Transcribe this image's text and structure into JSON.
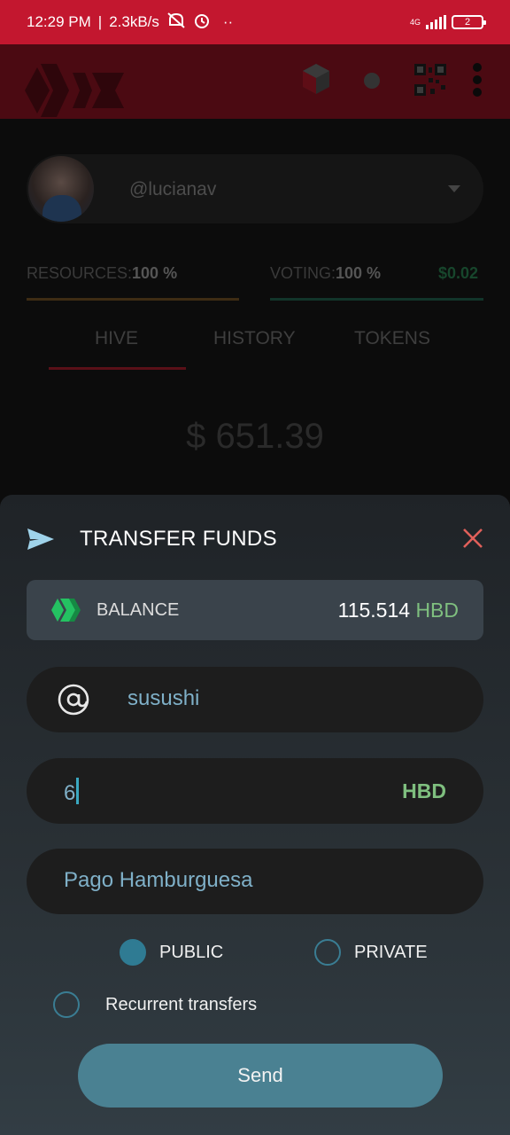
{
  "status_bar": {
    "time": "12:29 PM",
    "speed": "2.3kB/s",
    "network": "4G",
    "battery": "2"
  },
  "app_bar": {
    "icons": [
      "hive-logo",
      "cube-icon",
      "status-dot-icon",
      "qr-code-icon",
      "more-vert-icon"
    ]
  },
  "account": {
    "username": "@lucianav"
  },
  "resources": {
    "label": "RESOURCES:",
    "value": "100 %",
    "color": "#f0a44b"
  },
  "voting": {
    "label": "VOTING:",
    "value": "100 %",
    "amount": "$0.02",
    "color": "#3fbf7f"
  },
  "tabs": [
    "HIVE",
    "HISTORY",
    "TOKENS"
  ],
  "total": "$ 651.39",
  "transfer": {
    "title": "TRANSFER FUNDS",
    "balance_label": "BALANCE",
    "balance_value": "115.514",
    "balance_currency": "HBD",
    "recipient": "susushi",
    "amount": "6",
    "amount_currency": "HBD",
    "memo": "Pago Hamburguesa",
    "public_label": "PUBLIC",
    "private_label": "PRIVATE",
    "recurrent_label": "Recurrent transfers",
    "selected_privacy": "PUBLIC",
    "recurrent_enabled": false,
    "send_label": "Send"
  },
  "colors": {
    "brand": "#c3172f",
    "accent": "#4a8192",
    "currency": "#7fbf7f"
  }
}
